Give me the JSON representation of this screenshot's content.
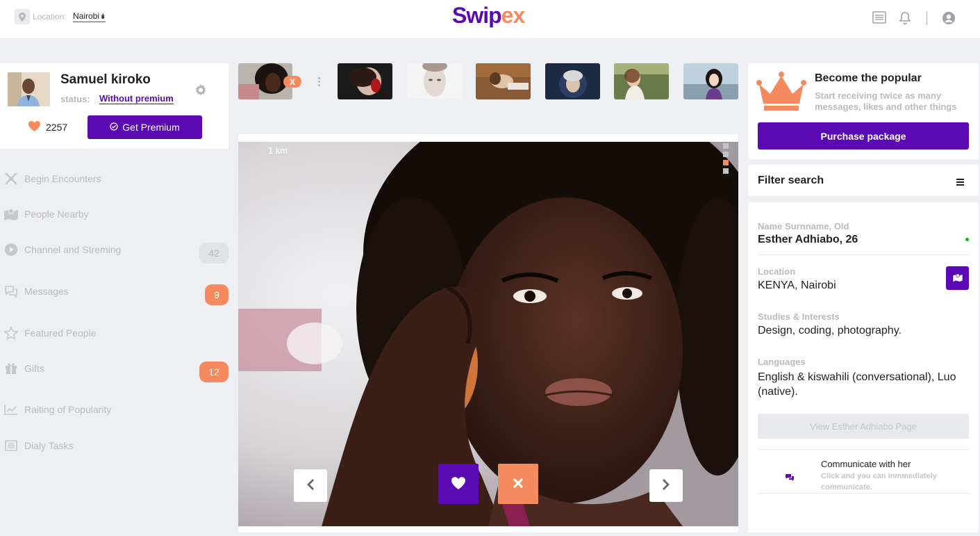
{
  "header": {
    "location_label": "Location:",
    "location_value": "Nairobi",
    "logo_part1": "Swip",
    "logo_part2": "ex"
  },
  "profile": {
    "name": "Samuel kiroko",
    "status_label": "status:",
    "status_value": "Without premium",
    "likes": "2257",
    "premium_button": "Get Premium"
  },
  "sidebar": {
    "items": [
      {
        "label": "Begin Encounters",
        "icon": "encounters-icon"
      },
      {
        "label": "People Nearby",
        "icon": "map-icon"
      },
      {
        "label": "Channel and Streming",
        "icon": "play-icon",
        "badge": "42"
      },
      {
        "label": "Messages",
        "icon": "chat-icon",
        "badge": "9"
      },
      {
        "label": "Featured People",
        "icon": "star-icon"
      },
      {
        "label": "Gifts",
        "icon": "gift-icon",
        "badge": "12"
      },
      {
        "label": "Raiting of Popularity",
        "icon": "chart-icon"
      },
      {
        "label": "Dialy Tasks",
        "icon": "list-icon"
      }
    ]
  },
  "strip": {
    "close_badge": "X"
  },
  "card": {
    "distance": "1 km"
  },
  "promo": {
    "title": "Become the popular",
    "description": "Start receiving twice as many messages, likes and other things",
    "button": "Purchase package"
  },
  "filter": {
    "title": "Filter search"
  },
  "details": {
    "name_label": "Name Surnname, Old",
    "name_value": "Esther Adhiabo, 26",
    "location_label": "Location",
    "location_value": "KENYA, Nairobi",
    "studies_label": "Studies & Interests",
    "studies_value": "Design, coding, photography.",
    "languages_label": "Languages",
    "languages_value": "English & kiswahili (conversational), Luo (native).",
    "view_button": "View Esther Adhiabo Page",
    "communicate_title": "Communicate with her",
    "communicate_desc": "Click and you can inmmediately communicate."
  },
  "colors": {
    "brand": "#5b09b3",
    "accent": "#f48a5d",
    "online": "#22a822"
  }
}
